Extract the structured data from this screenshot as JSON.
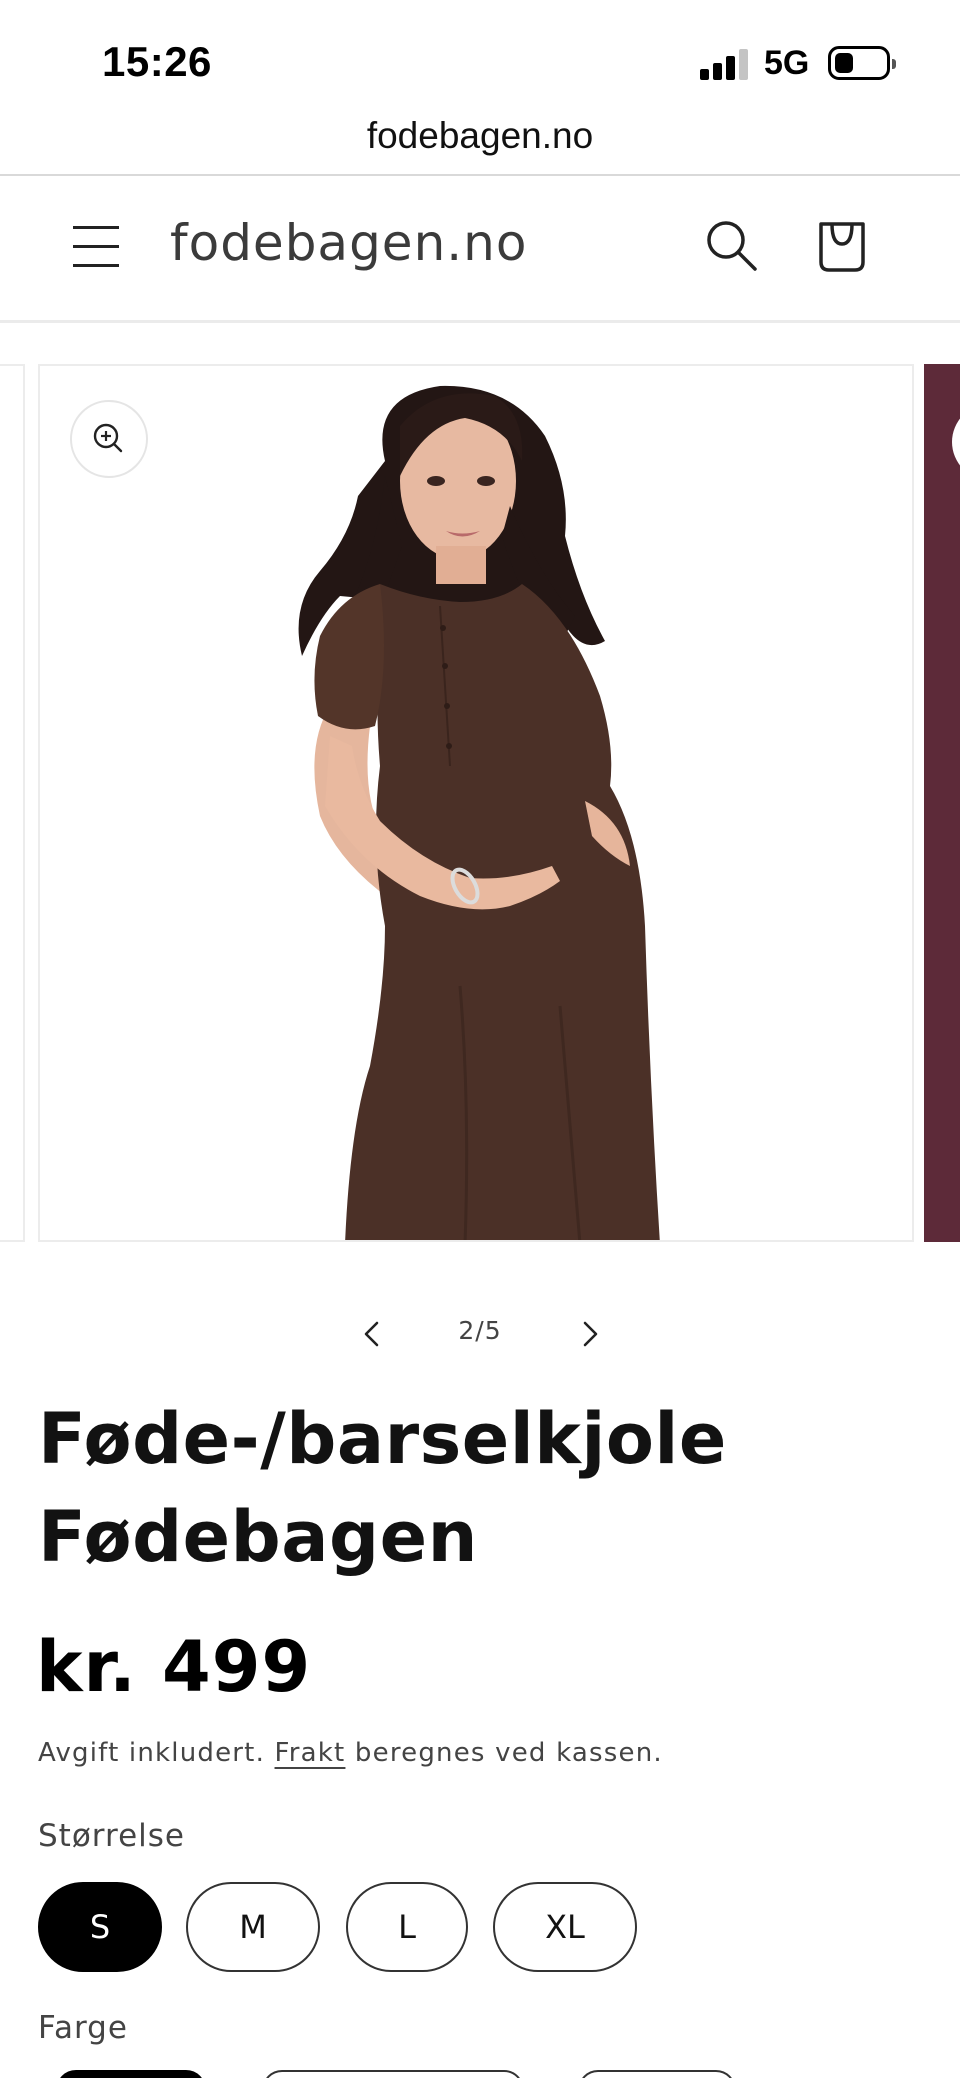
{
  "status_bar": {
    "time": "15:26",
    "network": "5G",
    "signal_bars_active": 3,
    "signal_bars_total": 4
  },
  "browser": {
    "url": "fodebagen.no"
  },
  "header": {
    "logo": "fodebagen.no",
    "icons": [
      "menu-icon",
      "search-icon",
      "cart-icon"
    ]
  },
  "gallery": {
    "current_slide": 2,
    "total_slides": 5,
    "counter": "2/5",
    "next_slide_color": "#5d2a39",
    "dress_color": "#4b3027"
  },
  "product": {
    "title_line1": "Føde-/barselkjole",
    "title_line2": "Fødebagen",
    "price": "kr. 499",
    "tax_prefix": "Avgift inkludert.",
    "tax_link": "Frakt",
    "tax_suffix": "beregnes ved kassen."
  },
  "size": {
    "label": "Størrelse",
    "options": [
      "S",
      "M",
      "L",
      "XL"
    ],
    "selected": "S"
  },
  "color": {
    "label": "Farge"
  }
}
